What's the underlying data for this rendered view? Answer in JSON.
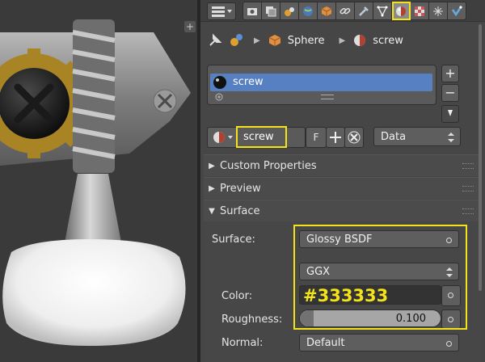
{
  "viewport": {
    "plus_label": "+"
  },
  "header": {
    "editor_type_icon": "properties-editor-icon",
    "context_tabs": [
      "render-icon",
      "render-layers-icon",
      "scene-icon",
      "world-icon",
      "object-icon",
      "constraints-icon",
      "modifiers-icon",
      "data-icon",
      "material-icon",
      "texture-icon",
      "particles-icon",
      "physics-icon"
    ],
    "active_tab": "material-icon",
    "highlight_color": "#f5e31a"
  },
  "breadcrumb": {
    "object": "Sphere",
    "material": "screw"
  },
  "material_slots": {
    "items": [
      {
        "name": "screw"
      }
    ],
    "add_label": "+",
    "remove_label": "−",
    "selection_color": "#5680c2"
  },
  "material_datablock": {
    "name": "screw",
    "fake_user_label": "F",
    "link_value": "Data"
  },
  "panels": {
    "custom_properties": "Custom Properties",
    "preview": "Preview",
    "surface": "Surface"
  },
  "surface": {
    "surface_label": "Surface:",
    "surface_value": "Glossy BSDF",
    "distribution_value": "GGX",
    "color_label": "Color:",
    "color_value": "#333333",
    "roughness_label": "Roughness:",
    "roughness_value": "0.100",
    "roughness_fraction": 0.1,
    "normal_label": "Normal:",
    "normal_value": "Default"
  }
}
